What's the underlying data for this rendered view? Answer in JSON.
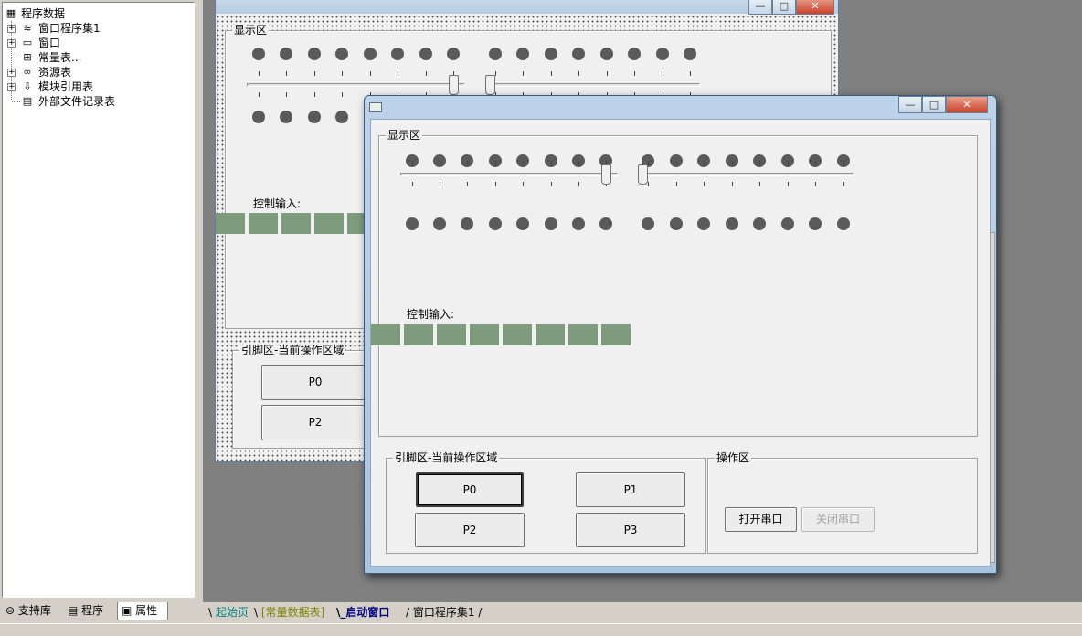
{
  "tree": {
    "root": "程序数据",
    "items": [
      {
        "label": "窗口程序集1",
        "expandable": true,
        "icon": "assembly-icon"
      },
      {
        "label": "窗口",
        "expandable": true,
        "icon": "window-icon"
      },
      {
        "label": "常量表...",
        "expandable": false,
        "icon": "constant-table-icon"
      },
      {
        "label": "资源表",
        "expandable": true,
        "icon": "resource-icon"
      },
      {
        "label": "模块引用表",
        "expandable": true,
        "icon": "module-icon"
      },
      {
        "label": "外部文件记录表",
        "expandable": false,
        "icon": "file-icon"
      }
    ]
  },
  "left_tabs": [
    {
      "label": "支持库",
      "icon": "library-icon"
    },
    {
      "label": "程序",
      "icon": "program-icon"
    },
    {
      "label": "属性",
      "icon": "property-icon"
    }
  ],
  "design_window": {
    "display_group": "显示区",
    "control_input_label": "控制输入:",
    "pin_group": "引脚区-当前操作区域",
    "pins": [
      "P0",
      "P2"
    ]
  },
  "run_window": {
    "display_group": "显示区",
    "control_input_label": "控制输入:",
    "pin_group": "引脚区-当前操作区域",
    "pins": [
      "P0",
      "P1",
      "P2",
      "P3"
    ],
    "op_group": "操作区",
    "open_port": "打开串口",
    "close_port": "关闭串口",
    "titlebar_buttons": {
      "minimize": "—",
      "maximize": "□",
      "close": "✕"
    },
    "slider_left_level": 1.0,
    "slider_right_level": 0.0
  },
  "bottom_tabs": [
    {
      "label": "起始页",
      "color": "#008080"
    },
    {
      "label": "[常量数据表]",
      "color": "#808000"
    },
    {
      "label": "_启动窗口",
      "color": "#000080"
    },
    {
      "label": "窗口程序集1",
      "color": "#000000"
    }
  ],
  "colors": {
    "led": "#5a5a5a",
    "input_box": "#7e9b7d",
    "desktop": "#808080"
  }
}
